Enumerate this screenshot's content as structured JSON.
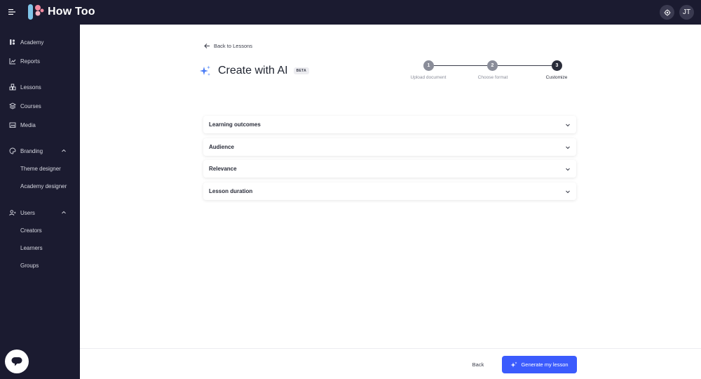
{
  "app": {
    "brand": "How Too",
    "avatar_initials": "JT"
  },
  "sidebar": {
    "items": [
      {
        "label": "Academy",
        "icon": "academy-icon"
      },
      {
        "label": "Reports",
        "icon": "chart-icon"
      },
      {
        "label": "Lessons",
        "icon": "lessons-icon"
      },
      {
        "label": "Courses",
        "icon": "layers-icon"
      },
      {
        "label": "Media",
        "icon": "image-icon"
      },
      {
        "label": "Branding",
        "icon": "palette-icon",
        "expanded": true
      },
      {
        "label": "Theme designer"
      },
      {
        "label": "Academy designer"
      },
      {
        "label": "Users",
        "icon": "users-icon",
        "expanded": true
      },
      {
        "label": "Creators"
      },
      {
        "label": "Learners"
      },
      {
        "label": "Groups"
      }
    ]
  },
  "main": {
    "back_link": "Back to Lessons",
    "title": "Create with AI",
    "badge": "BETA",
    "steps": [
      {
        "number": "1",
        "label": "Upload document",
        "state": "done"
      },
      {
        "number": "2",
        "label": "Choose format",
        "state": "done"
      },
      {
        "number": "3",
        "label": "Customize",
        "state": "active"
      }
    ],
    "sections": [
      {
        "label": "Learning outcomes"
      },
      {
        "label": "Audience"
      },
      {
        "label": "Relevance"
      },
      {
        "label": "Lesson duration"
      }
    ]
  },
  "footer": {
    "back_label": "Back",
    "generate_label": "Generate my lesson"
  },
  "colors": {
    "sidebar_bg": "#1b1b30",
    "accent": "#3b5bfd",
    "step_done": "#8a8d99",
    "step_active": "#2a2d3a"
  }
}
